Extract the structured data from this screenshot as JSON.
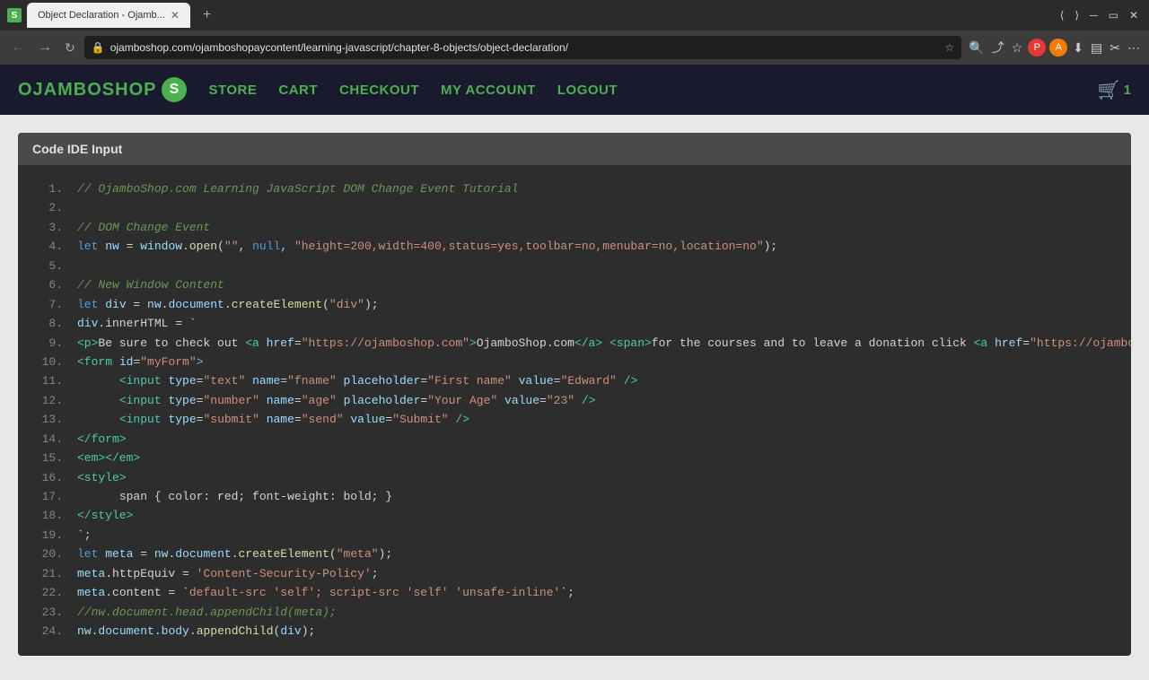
{
  "browser": {
    "tab_title": "Object Declaration - Ojamb...",
    "tab_favicon": "S",
    "url": "ojamboshop.com/ojamboshopaycontent/learning-javascript/chapter-8-objects/object-declaration/",
    "new_tab_label": "+",
    "win_controls": [
      "minimize",
      "maximize",
      "close"
    ]
  },
  "nav": {
    "logo_text": "OJAMBOSHOP",
    "logo_letter": "S",
    "links": [
      "STORE",
      "CART",
      "CHECKOUT",
      "MY ACCOUNT",
      "LOGOUT"
    ],
    "cart_count": "1"
  },
  "code_ide": {
    "header": "Code IDE Input"
  },
  "code_lines": [
    {
      "num": "1.",
      "content": "// OjamboShop.com Learning JavaScript DOM Change Event Tutorial",
      "type": "comment"
    },
    {
      "num": "2.",
      "content": "",
      "type": "plain"
    },
    {
      "num": "3.",
      "content": "// DOM Change Event",
      "type": "comment"
    },
    {
      "num": "4.",
      "content": "let nw = window.open(\"\", null, \"height=200,width=400,status=yes,toolbar=no,menubar=no,location=no\");",
      "type": "code4"
    },
    {
      "num": "5.",
      "content": "",
      "type": "plain"
    },
    {
      "num": "6.",
      "content": "// New Window Content",
      "type": "comment"
    },
    {
      "num": "7.",
      "content": "let div = nw.document.createElement(\"div\");",
      "type": "code7"
    },
    {
      "num": "8.",
      "content": "div.innerHTML = `",
      "type": "code8"
    },
    {
      "num": "9.",
      "content": "<p>Be sure to check out <a href=\"https://ojamboshop.com\">OjamboShop.com</a> <span>for the courses and to leave a donation click <a href=\"https://ojambo.com/donate\">here</a></span><p>",
      "type": "code9"
    },
    {
      "num": "10.",
      "content": "<form id=\"myForm\">",
      "type": "code10"
    },
    {
      "num": "11.",
      "content": "      <input type=\"text\" name=\"fname\" placeholder=\"First name\" value=\"Edward\" />",
      "type": "code11"
    },
    {
      "num": "12.",
      "content": "      <input type=\"number\" name=\"age\" placeholder=\"Your Age\" value=\"23\" />",
      "type": "code12"
    },
    {
      "num": "13.",
      "content": "      <input type=\"submit\" name=\"send\" value=\"Submit\" />",
      "type": "code13"
    },
    {
      "num": "14.",
      "content": "</form>",
      "type": "code14"
    },
    {
      "num": "15.",
      "content": "<em></em>",
      "type": "code15"
    },
    {
      "num": "16.",
      "content": "<style>",
      "type": "code16"
    },
    {
      "num": "17.",
      "content": "      span { color: red; font-weight: bold; }",
      "type": "code17"
    },
    {
      "num": "18.",
      "content": "</style>",
      "type": "code18"
    },
    {
      "num": "19.",
      "content": "`;",
      "type": "code19"
    },
    {
      "num": "20.",
      "content": "let meta = nw.document.createElement(\"meta\");",
      "type": "code20"
    },
    {
      "num": "21.",
      "content": "meta.httpEquiv = 'Content-Security-Policy';",
      "type": "code21"
    },
    {
      "num": "22.",
      "content": "meta.content = `default-src 'self'; script-src 'self' 'unsafe-inline'`;",
      "type": "code22"
    },
    {
      "num": "23.",
      "content": "//nw.document.head.appendChild(meta);",
      "type": "comment"
    },
    {
      "num": "24.",
      "content": "nw.document.body.appendChild(div);",
      "type": "code24"
    }
  ]
}
